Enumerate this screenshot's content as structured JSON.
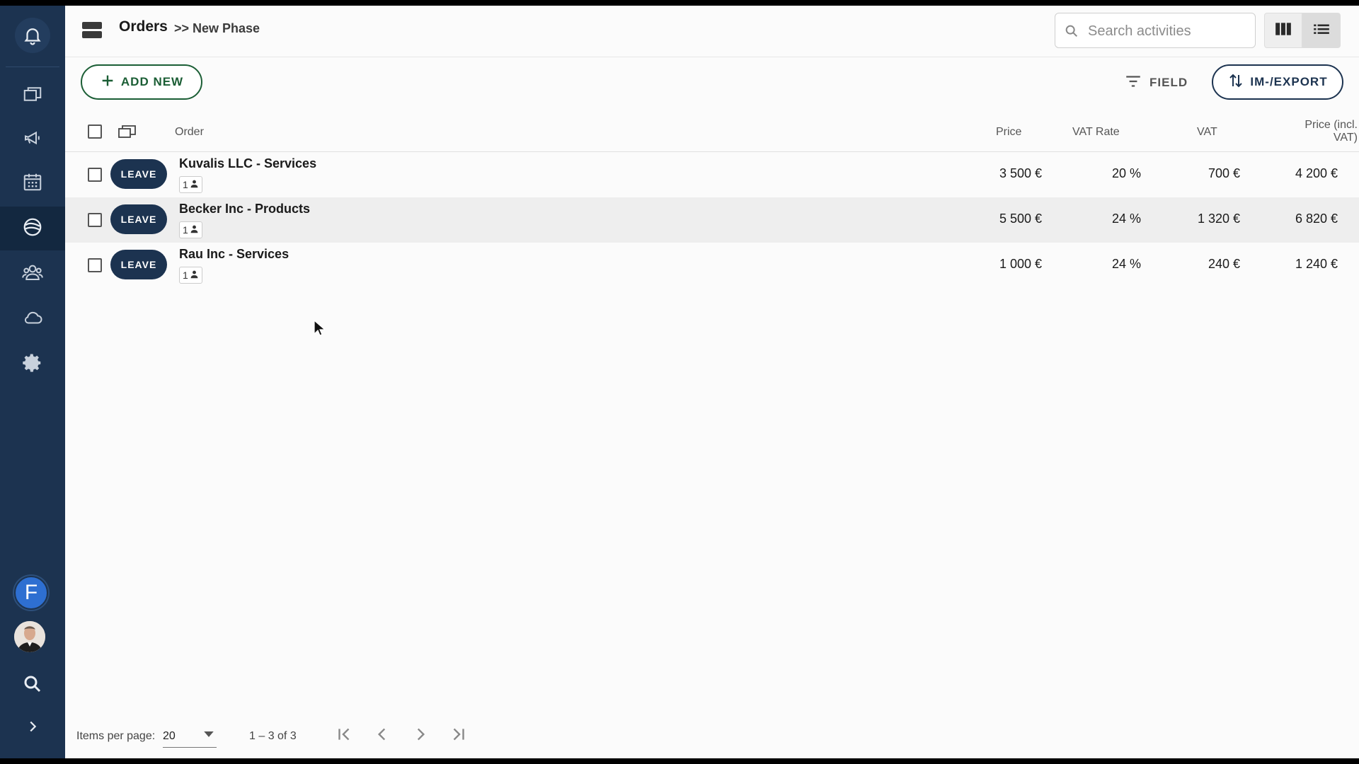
{
  "header": {
    "title": "Orders",
    "breadcrumb": ">> New Phase",
    "search_placeholder": "Search activities"
  },
  "sidebar": {
    "items": [
      {
        "name": "notifications",
        "icon": "bell-icon"
      },
      {
        "name": "projects",
        "icon": "windows-icon"
      },
      {
        "name": "campaigns",
        "icon": "megaphone-icon"
      },
      {
        "name": "calendar",
        "icon": "calendar-icon"
      },
      {
        "name": "deals",
        "icon": "deals-icon",
        "active": true
      },
      {
        "name": "contacts",
        "icon": "people-icon"
      },
      {
        "name": "cloud",
        "icon": "cloud-icon"
      },
      {
        "name": "settings",
        "icon": "gear-icon"
      }
    ],
    "account_initial": "F"
  },
  "toolbar": {
    "add_new_label": "ADD NEW",
    "field_label": "FIELD",
    "imexport_label": "IM-/EXPORT"
  },
  "table": {
    "columns": {
      "order": "Order",
      "price": "Price",
      "vat_rate": "VAT Rate",
      "vat": "VAT",
      "price_incl_line1": "Price (incl.",
      "price_incl_line2": "VAT)"
    },
    "rows": [
      {
        "action": "LEAVE",
        "name": "Kuvalis LLC - Services",
        "count": "1",
        "price": "3 500 €",
        "vat_rate": "20 %",
        "vat": "700 €",
        "price_incl": "4 200 €"
      },
      {
        "action": "LEAVE",
        "name": "Becker Inc - Products",
        "count": "1",
        "price": "5 500 €",
        "vat_rate": "24 %",
        "vat": "1 320 €",
        "price_incl": "6 820 €"
      },
      {
        "action": "LEAVE",
        "name": "Rau Inc - Services",
        "count": "1",
        "price": "1 000 €",
        "vat_rate": "24 %",
        "vat": "240 €",
        "price_incl": "1 240 €"
      }
    ]
  },
  "footer": {
    "items_per_page_label": "Items per page:",
    "items_per_page_value": "20",
    "range": "1 – 3 of 3"
  },
  "colors": {
    "sidebar": "#1c3350",
    "accent_green": "#1b5e35",
    "primary_dark": "#1c3350"
  }
}
